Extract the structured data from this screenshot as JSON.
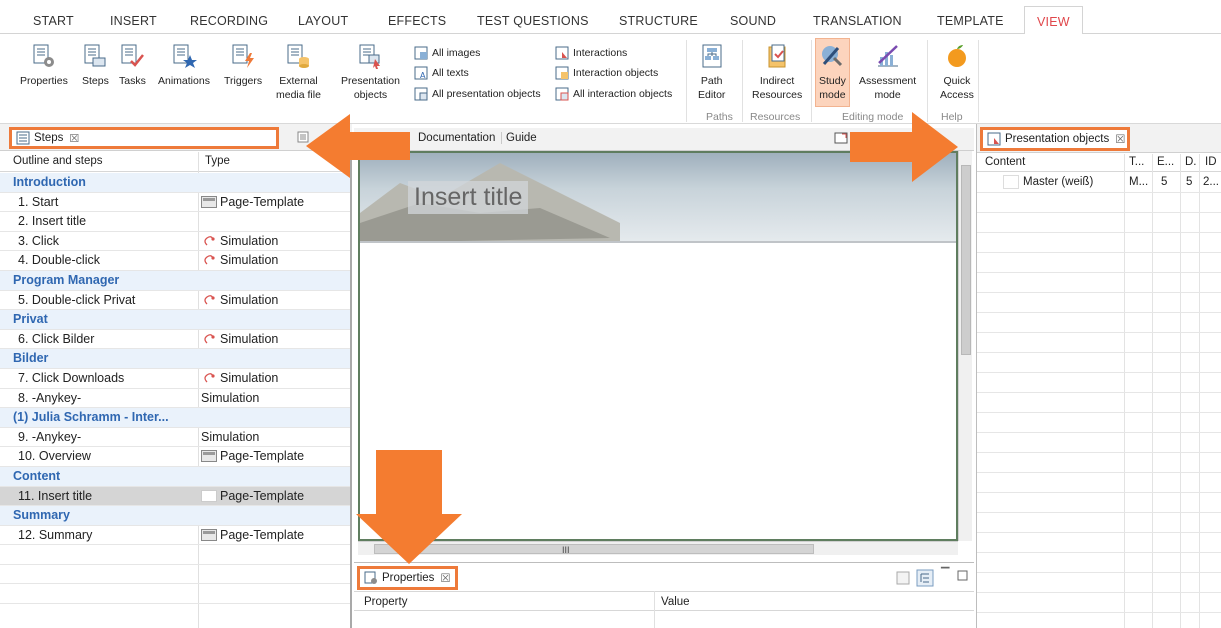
{
  "menu": {
    "tabs": [
      "START",
      "INSERT",
      "RECORDING",
      "LAYOUT",
      "EFFECTS",
      "TEST QUESTIONS",
      "STRUCTURE",
      "SOUND",
      "TRANSLATION",
      "TEMPLATE",
      "VIEW"
    ],
    "active_tab": "VIEW"
  },
  "ribbon": {
    "buttons": {
      "properties": "Properties",
      "steps": "Steps",
      "tasks": "Tasks",
      "animations": "Animations",
      "triggers": "Triggers",
      "external_line1": "External",
      "external_line2": "media file",
      "presentation_line1": "Presentation",
      "presentation_line2": "objects",
      "all_images": "All images",
      "all_texts": "All texts",
      "all_presentation_objects": "All presentation objects",
      "interactions": "Interactions",
      "interaction_objects": "Interaction objects",
      "all_interaction_objects": "All interaction objects",
      "path_line1": "Path",
      "path_line2": "Editor",
      "indirect_line1": "Indirect",
      "indirect_line2": "Resources",
      "study_line1": "Study",
      "study_line2": "mode",
      "assessment_line1": "Assessment",
      "assessment_line2": "mode",
      "quick_line1": "Quick",
      "quick_line2": "Access"
    },
    "groups": {
      "paths": "Paths",
      "resources": "Resources",
      "editing_mode": "Editing mode",
      "help": "Help"
    }
  },
  "steps_panel": {
    "title": "Steps",
    "close": "☒",
    "col_outline": "Outline and steps",
    "col_type": "Type",
    "rows": [
      {
        "kind": "group",
        "label": "Introduction",
        "type": ""
      },
      {
        "kind": "step",
        "label": "1. Start",
        "type": "Page-Template",
        "icon": "page-template-icon"
      },
      {
        "kind": "step",
        "label": "2. Insert title",
        "type": "",
        "icon": ""
      },
      {
        "kind": "step",
        "label": "3. Click",
        "type": "Simulation",
        "icon": "simulation-icon"
      },
      {
        "kind": "step",
        "label": "4. Double-click",
        "type": "Simulation",
        "icon": "simulation-icon"
      },
      {
        "kind": "group",
        "label": "Program Manager",
        "type": ""
      },
      {
        "kind": "step",
        "label": "5. Double-click Privat",
        "type": "Simulation",
        "icon": "simulation-icon"
      },
      {
        "kind": "group",
        "label": "Privat",
        "type": ""
      },
      {
        "kind": "step",
        "label": "6. Click Bilder",
        "type": "Simulation",
        "icon": "simulation-icon"
      },
      {
        "kind": "group",
        "label": "Bilder",
        "type": ""
      },
      {
        "kind": "step",
        "label": "7. Click Downloads",
        "type": "Simulation",
        "icon": "simulation-icon"
      },
      {
        "kind": "step",
        "label": "8.  -Anykey-",
        "type": "Simulation",
        "icon": ""
      },
      {
        "kind": "group",
        "label": "(1) Julia Schramm - Inter...",
        "type": ""
      },
      {
        "kind": "step",
        "label": "9.  -Anykey-",
        "type": "Simulation",
        "icon": ""
      },
      {
        "kind": "step",
        "label": "10. Overview",
        "type": "Page-Template",
        "icon": "page-template-icon"
      },
      {
        "kind": "group",
        "label": "Content",
        "type": ""
      },
      {
        "kind": "step",
        "label": "11. Insert title",
        "type": "Page-Template",
        "icon": "blank-page-icon",
        "selected": true
      },
      {
        "kind": "group",
        "label": "Summary",
        "type": ""
      },
      {
        "kind": "step",
        "label": "12. Summary",
        "type": "Page-Template",
        "icon": "page-template-icon"
      }
    ]
  },
  "editor": {
    "tab_documentation": "Documentation",
    "tab_guide": "Guide",
    "slide_title": "Insert title",
    "scroll_dots": "III"
  },
  "properties_panel": {
    "title": "Properties",
    "close": "☒",
    "col_property": "Property",
    "col_value": "Value"
  },
  "presentation_panel": {
    "title": "Presentation objects",
    "close": "☒",
    "col_content": "Content",
    "col_t": "T...",
    "col_e": "E...",
    "col_d": "D.",
    "col_id": "ID",
    "row": {
      "content": "Master (weiß)",
      "t": "M...",
      "e": "5",
      "d": "5",
      "id": "2..."
    }
  },
  "colors": {
    "accent": "#e0464a",
    "highlight": "#ee7a3a",
    "group_text": "#2f67b1"
  }
}
